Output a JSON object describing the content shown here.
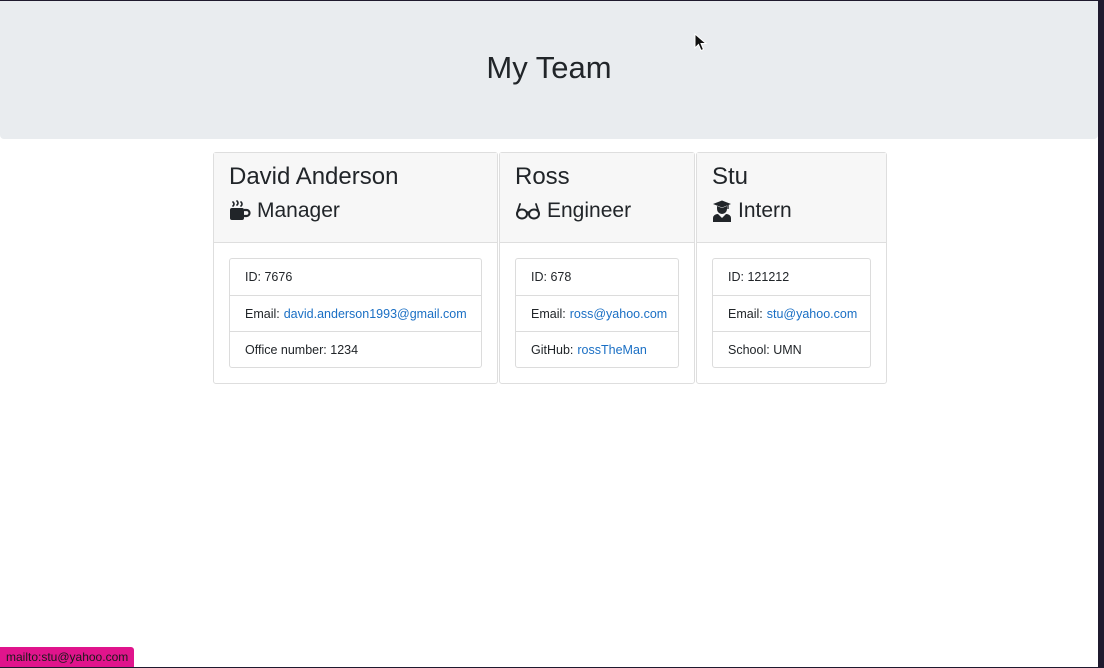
{
  "header": {
    "title": "My Team"
  },
  "team": [
    {
      "name": "David Anderson",
      "role": "Manager",
      "role_icon": "coffee-mug-icon",
      "id_label": "ID:",
      "id": "7676",
      "email_label": "Email:",
      "email": "david.anderson1993@gmail.com",
      "extra_label": "Office number:",
      "extra_value": "1234"
    },
    {
      "name": "Ross",
      "role": "Engineer",
      "role_icon": "glasses-icon",
      "id_label": "ID:",
      "id": "678",
      "email_label": "Email:",
      "email": "ross@yahoo.com",
      "extra_label": "GitHub:",
      "extra_value": "rossTheMan"
    },
    {
      "name": "Stu",
      "role": "Intern",
      "role_icon": "graduate-icon",
      "id_label": "ID:",
      "id": "121212",
      "email_label": "Email:",
      "email": "stu@yahoo.com",
      "extra_label": "School:",
      "extra_value": "UMN"
    }
  ],
  "status_bar": {
    "text": "mailto:stu@yahoo.com"
  },
  "colors": {
    "jumbotron": "#e9ecef",
    "link": "#1a6fc4",
    "status_bar": "#e0148c"
  }
}
